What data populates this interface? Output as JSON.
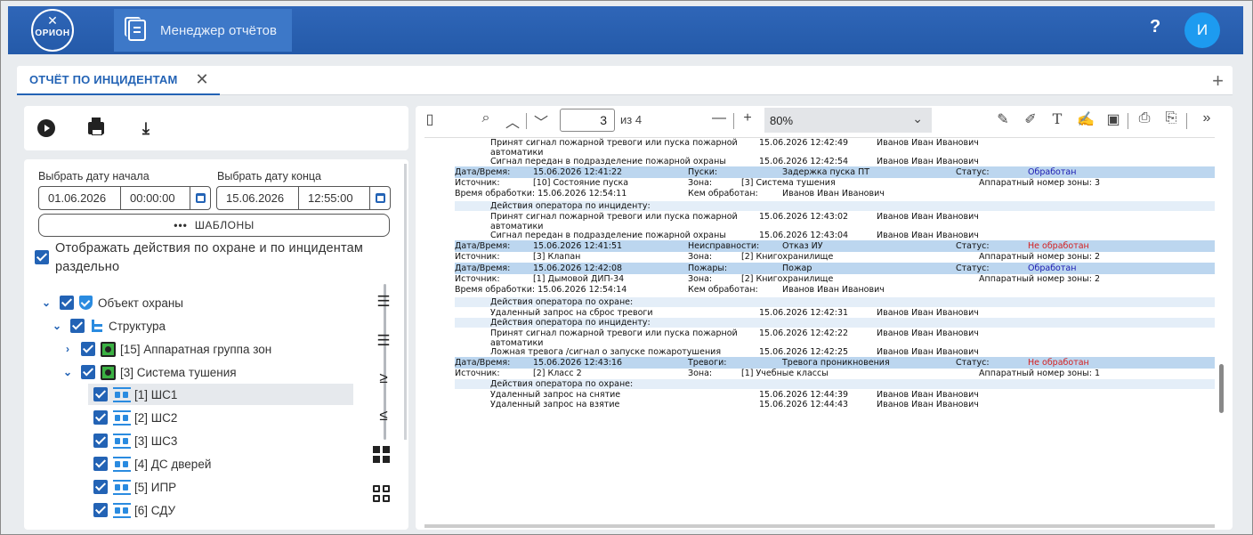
{
  "app": {
    "logo_text": "ОРИОН",
    "tab_title": "Менеджер отчётов",
    "help_label": "?",
    "user_initial": "И"
  },
  "tabs": {
    "active_label": "ОТЧЁТ ПО ИНЦИДЕНТАМ",
    "close_label": "✕",
    "add_label": "+"
  },
  "filters": {
    "start_label": "Выбрать дату начала",
    "end_label": "Выбрать дату конца",
    "start_date": "01.06.2026",
    "start_time": "00:00:00",
    "end_date": "15.06.2026",
    "end_time": "12:55:00",
    "templates_dots": "•••",
    "templates_label": "ШАБЛОНЫ",
    "separate_label": "Отображать действия по охране и по инцидентам раздельно",
    "separate_checked": true
  },
  "tree": [
    {
      "label": "Объект охраны",
      "level": 0,
      "icon": "shield-icon",
      "expanded": true
    },
    {
      "label": "Структура",
      "level": 1,
      "icon": "structure-icon",
      "expanded": true
    },
    {
      "label": "[15] Аппаратная группа зон",
      "level": 2,
      "icon": "group-icon",
      "expanded": false
    },
    {
      "label": "[3] Система тушения",
      "level": 2,
      "icon": "group-icon",
      "expanded": true
    },
    {
      "label": "[1] ШС1",
      "level": 3,
      "icon": "zone-icon",
      "selected": true
    },
    {
      "label": "[2] ШС2",
      "level": 3,
      "icon": "zone-icon"
    },
    {
      "label": "[3] ШС3",
      "level": 3,
      "icon": "zone-icon"
    },
    {
      "label": "[4] ДС дверей",
      "level": 3,
      "icon": "zone-icon"
    },
    {
      "label": "[5] ИПР",
      "level": 3,
      "icon": "zone-icon"
    },
    {
      "label": "[6] СДУ",
      "level": 3,
      "icon": "zone-icon"
    }
  ],
  "viewer": {
    "page_current": "3",
    "page_total": "из 4",
    "zoom": "80%"
  },
  "report": [
    {
      "type": "action",
      "cols": [
        "Принят сигнал пожарной тревоги или пуска пожарной",
        "15.06.2026 12:42:49",
        "Иванов Иван Иванович"
      ]
    },
    {
      "type": "cont",
      "cols": [
        "автоматики"
      ]
    },
    {
      "type": "action",
      "cols": [
        "Сигнал передан в подразделение пожарной охраны",
        "15.06.2026 12:42:54",
        "Иванов Иван Иванович"
      ]
    },
    {
      "type": "hdr",
      "status_class": "blue",
      "cols": [
        "Дата/Время:",
        "15.06.2026 12:41:22",
        "Пуски:",
        "Задержка пуска ПТ",
        "Статус:",
        "Обработан"
      ]
    },
    {
      "type": "src",
      "cols": [
        "Источник:",
        "[10] Состояние пуска",
        "Зона:",
        "[3] Система тушения",
        "Аппаратный номер зоны:  3"
      ]
    },
    {
      "type": "proc",
      "cols": [
        "Время обработки:  15.06.2026 12:54:11",
        "Кем обработан:",
        "Иванов Иван Иванович"
      ]
    },
    {
      "type": "sub",
      "cols": [
        "Действия оператора по инциденту:"
      ]
    },
    {
      "type": "action",
      "cols": [
        "Принят сигнал пожарной тревоги или пуска пожарной",
        "15.06.2026 12:43:02",
        "Иванов Иван Иванович"
      ]
    },
    {
      "type": "cont",
      "cols": [
        "автоматики"
      ]
    },
    {
      "type": "action",
      "cols": [
        "Сигнал передан в подразделение пожарной охраны",
        "15.06.2026 12:43:04",
        "Иванов Иван Иванович"
      ]
    },
    {
      "type": "hdr",
      "status_class": "red",
      "cols": [
        "Дата/Время:",
        "15.06.2026 12:41:51",
        "Неисправности:",
        "Отказ ИУ",
        "Статус:",
        "Не обработан"
      ]
    },
    {
      "type": "src",
      "cols": [
        "Источник:",
        "[3] Клапан",
        "Зона:",
        "[2] Книгохранилище",
        "Аппаратный номер зоны:  2"
      ]
    },
    {
      "type": "hdr",
      "status_class": "blue",
      "cols": [
        "Дата/Время:",
        "15.06.2026 12:42:08",
        "Пожары:",
        "Пожар",
        "Статус:",
        "Обработан"
      ]
    },
    {
      "type": "src",
      "cols": [
        "Источник:",
        "[1] Дымовой ДИП-34",
        "Зона:",
        "[2] Книгохранилище",
        "Аппаратный номер зоны:  2"
      ]
    },
    {
      "type": "proc",
      "cols": [
        "Время обработки:  15.06.2026 12:54:14",
        "Кем обработан:",
        "Иванов Иван Иванович"
      ]
    },
    {
      "type": "sub",
      "cols": [
        "Действия оператора по охране:"
      ]
    },
    {
      "type": "action",
      "cols": [
        "Удаленный запрос на сброс тревоги",
        "15.06.2026 12:42:31",
        "Иванов Иван Иванович"
      ]
    },
    {
      "type": "sub",
      "cols": [
        "Действия оператора по инциденту:"
      ]
    },
    {
      "type": "action",
      "cols": [
        "Принят сигнал пожарной тревоги или пуска пожарной",
        "15.06.2026 12:42:22",
        "Иванов Иван Иванович"
      ]
    },
    {
      "type": "cont",
      "cols": [
        "автоматики"
      ]
    },
    {
      "type": "action",
      "cols": [
        "Ложная тревога /сигнал о запуске пожаротушения",
        "15.06.2026 12:42:25",
        "Иванов Иван Иванович"
      ]
    },
    {
      "type": "hdr",
      "status_class": "red",
      "cols": [
        "Дата/Время:",
        "15.06.2026 12:43:16",
        "Тревоги:",
        "Тревога проникновения",
        "Статус:",
        "Не обработан"
      ]
    },
    {
      "type": "src",
      "cols": [
        "Источник:",
        "[2] Класс 2",
        "Зона:",
        "[1] Учебные классы",
        "Аппаратный номер зоны:  1"
      ]
    },
    {
      "type": "sub",
      "cols": [
        "Действия оператора по охране:"
      ]
    },
    {
      "type": "action",
      "cols": [
        "Удаленный запрос на снятие",
        "15.06.2026 12:44:39",
        "Иванов Иван Иванович"
      ]
    },
    {
      "type": "action",
      "cols": [
        "Удаленный запрос на взятие",
        "15.06.2026 12:44:43",
        "Иванов Иван Иванович"
      ]
    }
  ]
}
